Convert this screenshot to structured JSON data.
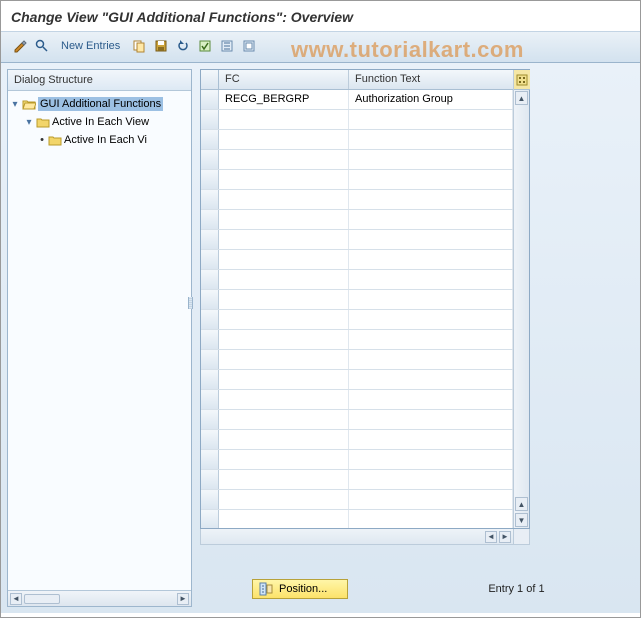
{
  "title": "Change View \"GUI Additional Functions\": Overview",
  "watermark": "www.tutorialkart.com",
  "toolbar": {
    "new_entries": "New Entries"
  },
  "sidebar": {
    "header": "Dialog Structure",
    "nodes": {
      "root_label": "GUI Additional Functions",
      "child1_label": "Active In Each View",
      "child2_label": "Active In Each Vi"
    }
  },
  "table": {
    "columns": {
      "fc": "FC",
      "text": "Function Text"
    },
    "rows": [
      {
        "fc": "RECG_BERGRP",
        "text": "Authorization Group"
      }
    ]
  },
  "footer": {
    "position_btn": "Position...",
    "entry_text": "Entry 1 of 1"
  }
}
